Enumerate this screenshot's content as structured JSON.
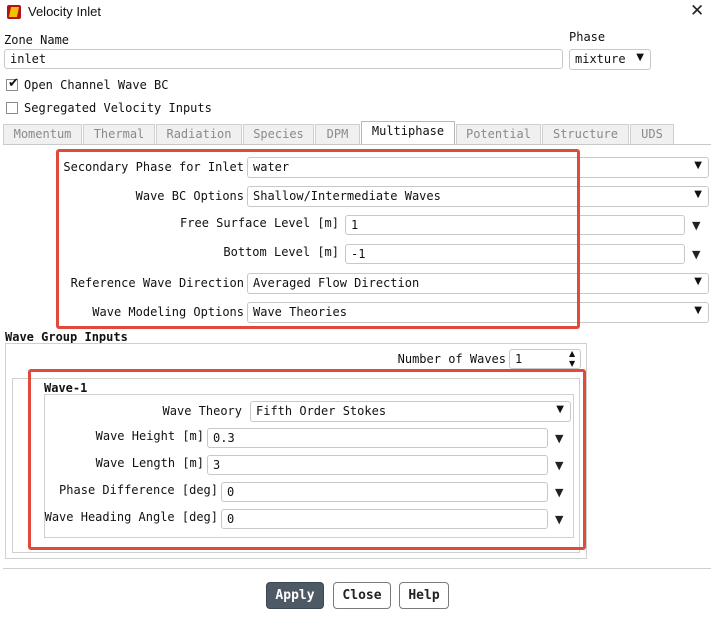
{
  "window": {
    "title": "Velocity Inlet",
    "close_glyph": "✕"
  },
  "zone": {
    "label": "Zone Name",
    "value": "inlet"
  },
  "phase": {
    "label": "Phase",
    "value": "mixture"
  },
  "checkboxes": {
    "open_channel": {
      "label": "Open Channel Wave BC",
      "checked": true
    },
    "segregated": {
      "label": "Segregated Velocity Inputs",
      "checked": false
    }
  },
  "tabs": [
    {
      "label": "Momentum"
    },
    {
      "label": "Thermal"
    },
    {
      "label": "Radiation"
    },
    {
      "label": "Species"
    },
    {
      "label": "DPM"
    },
    {
      "label": "Multiphase"
    },
    {
      "label": "Potential"
    },
    {
      "label": "Structure"
    },
    {
      "label": "UDS"
    }
  ],
  "active_tab": "Multiphase",
  "multiphase": {
    "secondary_phase": {
      "label": "Secondary Phase for Inlet",
      "value": "water"
    },
    "wave_bc_options": {
      "label": "Wave BC Options",
      "value": "Shallow/Intermediate Waves"
    },
    "free_surface_level": {
      "label": "Free Surface Level [m]",
      "value": "1"
    },
    "bottom_level": {
      "label": "Bottom Level [m]",
      "value": "-1"
    },
    "reference_wave_direction": {
      "label": "Reference Wave Direction",
      "value": "Averaged Flow Direction"
    },
    "wave_modeling_options": {
      "label": "Wave Modeling Options",
      "value": "Wave Theories"
    }
  },
  "wave_group": {
    "title": "Wave Group Inputs",
    "number_of_waves": {
      "label": "Number of Waves",
      "value": "1"
    }
  },
  "wave1": {
    "title": "Wave-1",
    "wave_theory": {
      "label": "Wave Theory",
      "value": "Fifth Order Stokes"
    },
    "wave_height": {
      "label": "Wave Height [m]",
      "value": "0.3"
    },
    "wave_length": {
      "label": "Wave Length [m]",
      "value": "3"
    },
    "phase_difference": {
      "label": "Phase Difference [deg]",
      "value": "0"
    },
    "wave_heading_angle": {
      "label": "Wave Heading Angle [deg]",
      "value": "0"
    }
  },
  "buttons": {
    "apply": "Apply",
    "close": "Close",
    "help": "Help"
  },
  "icons": {
    "dropdown": "▼",
    "spin_up": "▲",
    "spin_down": "▼",
    "checkmark": "✔"
  },
  "colors": {
    "highlight": "#e04a3a",
    "apply_bg": "#4e5966"
  }
}
